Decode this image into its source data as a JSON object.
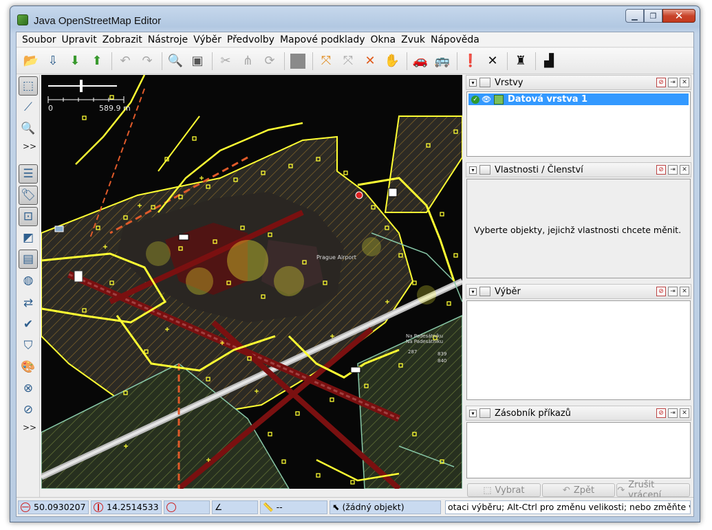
{
  "window": {
    "title": "Java OpenStreetMap Editor",
    "buttons": [
      "minimize",
      "maximize",
      "close"
    ]
  },
  "menu": [
    "Soubor",
    "Upravit",
    "Zobrazit",
    "Nástroje",
    "Výběr",
    "Předvolby",
    "Mapové podklady",
    "Okna",
    "Zvuk",
    "Nápověda"
  ],
  "toolbar": {
    "icons": [
      "open-file-icon",
      "save-icon",
      "download-icon",
      "upload-icon",
      "undo-icon",
      "redo-icon",
      "preferences-icon",
      "properties-icon",
      "split-way-icon",
      "combine-way-icon",
      "refresh-icon",
      "imagery-icon",
      "move-tool-icon",
      "select-tool-icon",
      "delete-tool-icon",
      "pan-hand-icon",
      "car-icon",
      "bus-icon",
      "warning-icon",
      "cross-icon",
      "castle-icon",
      "factory-icon"
    ]
  },
  "left_tools": {
    "more_label_1": ">>",
    "more_label_2": ">>"
  },
  "map": {
    "scale_zero": "0",
    "scale_label": "589.9 m",
    "labels": [
      "Prague Airport",
      "Na Padesátníku",
      "Na Padesátníku",
      "839",
      "840",
      "287"
    ]
  },
  "panels": {
    "layers": {
      "title": "Vrstvy",
      "items": [
        {
          "name": "Datová vrstva 1"
        }
      ]
    },
    "properties": {
      "title": "Vlastnosti / Členství",
      "message": "Vyberte objekty, jejichž vlastnosti chcete měnit."
    },
    "selection": {
      "title": "Výběr"
    },
    "commands": {
      "title": "Zásobník příkazů",
      "buttons": {
        "select": "Vybrat",
        "undo": "Zpět",
        "redo": "Zrušit vrácení"
      }
    }
  },
  "status": {
    "lat": "50.0930207",
    "lon": "14.2514533",
    "heading": "",
    "angle": "",
    "distance": "--",
    "object": "(žádný objekt)",
    "help": "otaci výběru; Alt-Ctrl pro změnu velikosti; nebo změňte výběr"
  },
  "colors": {
    "selection_highlight": "#3399ff",
    "node_yellow": "#ffff00",
    "status_field": "#c9daf0"
  }
}
